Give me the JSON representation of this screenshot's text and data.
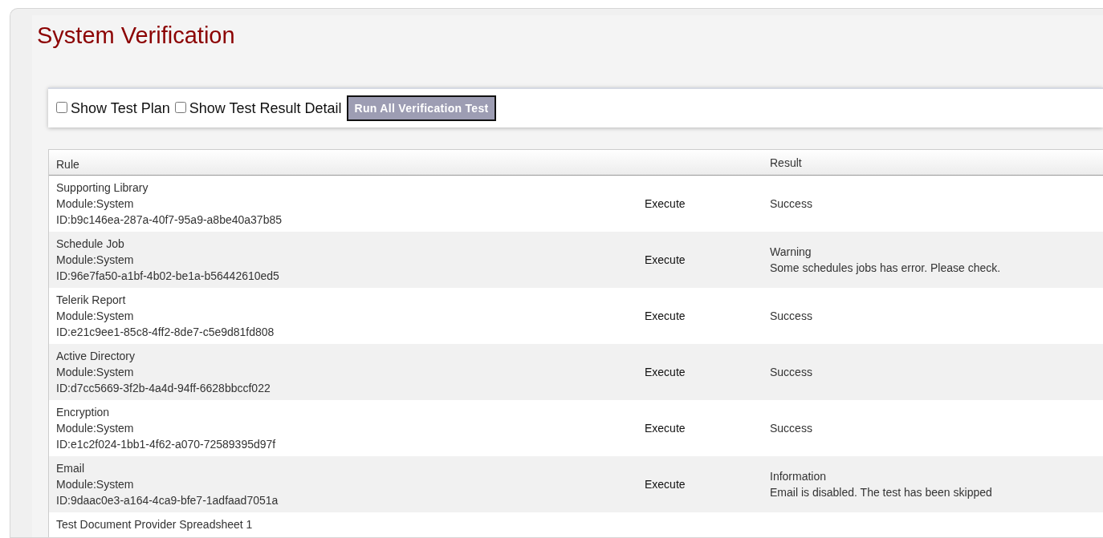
{
  "page": {
    "title": "System Verification"
  },
  "toolbar": {
    "options": [
      {
        "label": "Show Test Plan",
        "checked": false
      },
      {
        "label": "Show Test Result Detail",
        "checked": false
      }
    ],
    "button": "Run All Verification Test"
  },
  "table": {
    "columns": [
      "Rule",
      "",
      "Result"
    ],
    "rows": [
      {
        "name": "Supporting Library",
        "module": "Module:System",
        "id": "ID:b9c146ea-287a-40f7-95a9-a8be40a37b85",
        "action": "Execute",
        "result": [
          "Success"
        ]
      },
      {
        "name": "Schedule Job",
        "module": "Module:System",
        "id": "ID:96e7fa50-a1bf-4b02-be1a-b56442610ed5",
        "action": "Execute",
        "result": [
          "Warning",
          "Some schedules jobs has error. Please check."
        ]
      },
      {
        "name": "Telerik Report",
        "module": "Module:System",
        "id": "ID:e21c9ee1-85c8-4ff2-8de7-c5e9d81fd808",
        "action": "Execute",
        "result": [
          "Success"
        ]
      },
      {
        "name": "Active Directory",
        "module": "Module:System",
        "id": "ID:d7cc5669-3f2b-4a4d-94ff-6628bbccf022",
        "action": "Execute",
        "result": [
          "Success"
        ]
      },
      {
        "name": "Encryption",
        "module": "Module:System",
        "id": "ID:e1c2f024-1bb1-4f62-a070-72589395d97f",
        "action": "Execute",
        "result": [
          "Success"
        ]
      },
      {
        "name": "Email",
        "module": "Module:System",
        "id": "ID:9daac0e3-a164-4ca9-bfe7-1adfaad7051a",
        "action": "Execute",
        "result": [
          "Information",
          "Email is disabled. The test has been skipped"
        ]
      },
      {
        "name": "Test Document Provider Spreadsheet 1"
      }
    ]
  }
}
